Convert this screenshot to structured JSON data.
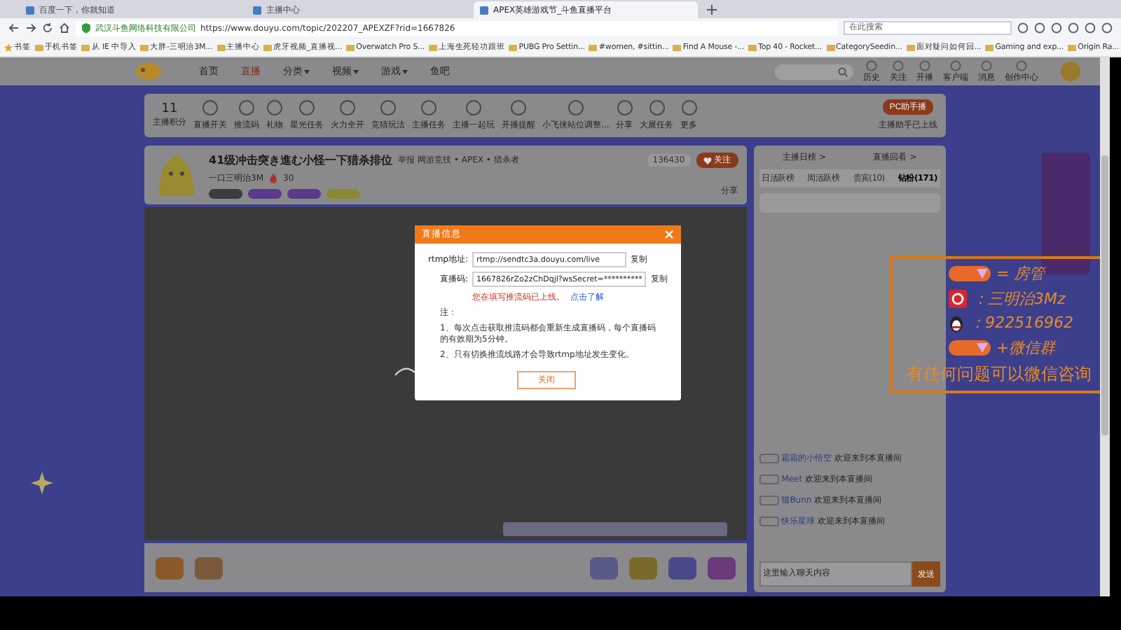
{
  "browser": {
    "tabs": [
      {
        "title": "百度一下，你就知道",
        "selected": false
      },
      {
        "title": "主播中心",
        "selected": false
      },
      {
        "title": "APEX英雄游戏节_斗鱼直播平台",
        "selected": true
      }
    ],
    "site_name": "武汉斗鱼网络科技有限公司",
    "url": "https://www.douyu.com/topic/202207_APEXZF?rid=1667826",
    "search_placeholder": "在此搜索",
    "bookmarks": [
      "书签",
      "手机书签",
      "从 IE 中导入",
      "大胖-三明治3M...",
      "主播中心",
      "虎牙视频_直播视...",
      "Overwatch Pro S...",
      "上海生死轻功跟班",
      "PUBG Pro Settin...",
      "#women, #sittin...",
      "Find A Mouse -...",
      "Top 40 - Rocket...",
      "CategorySeedin...",
      "面对疑问如何回...",
      "Gaming and exp...",
      "Origin Ra..."
    ]
  },
  "nav": {
    "items": [
      {
        "label": "首页",
        "selected": false,
        "dropdown": false
      },
      {
        "label": "直播",
        "selected": true,
        "dropdown": false
      },
      {
        "label": "分类",
        "selected": false,
        "dropdown": true
      },
      {
        "label": "视频",
        "selected": false,
        "dropdown": true
      },
      {
        "label": "游戏",
        "selected": false,
        "dropdown": true
      },
      {
        "label": "鱼吧",
        "selected": false,
        "dropdown": false
      }
    ],
    "actions": [
      "历史",
      "关注",
      "开播",
      "客户端",
      "消息",
      "创作中心"
    ]
  },
  "toolbar": {
    "score": "11",
    "score_label": "主播积分",
    "tools": [
      "直播开关",
      "推流码",
      "礼物",
      "星光任务",
      "火力全开",
      "竞猜玩法",
      "主播任务",
      "主播一起玩",
      "开播提醒",
      "小飞侠站位调整...",
      "分享",
      "大展任务",
      "更多"
    ],
    "pc_button": "PC助手播",
    "pc_note": "主播助手已上线"
  },
  "room": {
    "title": "41级冲击突き進む小怪一下猎杀排位",
    "meta": "举报  网游竞技 • APEX • 猎杀者",
    "anchor": "一口三明治3M",
    "hot": "30",
    "follow_count": "136430",
    "follow_button": "关注",
    "share": "分享"
  },
  "dialog": {
    "title": "直播信息",
    "fields": [
      {
        "label": "rtmp地址:",
        "value": "rtmp://sendtc3a.douyu.com/live",
        "copy": "复制"
      },
      {
        "label": "直播码:",
        "value": "1667826rZo2zChDqjl?wsSecret=**********",
        "copy": "复制"
      }
    ],
    "warning": "您在填写推流码已上线。",
    "link": "点击了解",
    "notes": [
      "注：",
      "1、每次点击获取推流码都会重新生成直播码，每个直播码的有效期为5分钟。",
      "2、只有切换推流线路才会导致rtmp地址发生变化。"
    ],
    "button": "关闭"
  },
  "chat": {
    "links": [
      "主播日榜 >",
      "直播回看 >"
    ],
    "tabs": [
      {
        "label": "日活跃榜",
        "selected": false
      },
      {
        "label": "周活跃榜",
        "selected": false
      },
      {
        "label": "贵宾(10)",
        "selected": false
      },
      {
        "label": "钻粉(171)",
        "selected": true
      }
    ],
    "messages": [
      {
        "user": "霜霜的小悟空",
        "text": "欢迎来到本直播间"
      },
      {
        "user": "Meet",
        "text": "欢迎来到本直播间"
      },
      {
        "user": "猫Bunn",
        "text": "欢迎来到本直播间"
      },
      {
        "user": "快乐星球",
        "text": "欢迎来到本直播间"
      }
    ],
    "input_placeholder": "这里输入聊天内容",
    "send": "发送"
  },
  "overlay": {
    "rows": [
      {
        "kind": "badge",
        "text": "= 房管"
      },
      {
        "kind": "weibo",
        "text": "：三明治3Mz"
      },
      {
        "kind": "qq",
        "text": "：922516962"
      },
      {
        "kind": "badge",
        "text": "+微信群"
      },
      {
        "kind": "plain",
        "text": "有任何问题可以微信咨询"
      }
    ]
  }
}
